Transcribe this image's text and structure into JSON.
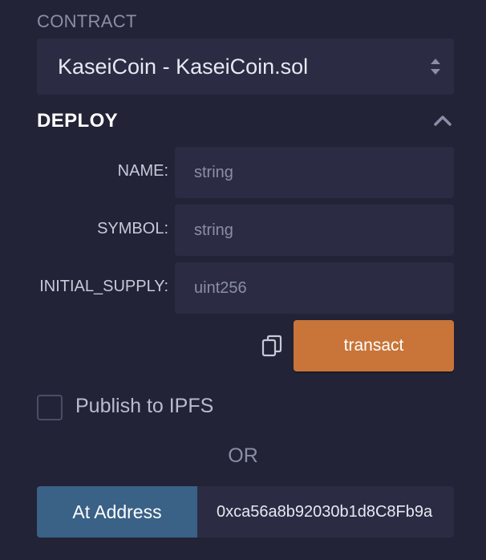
{
  "contract": {
    "label": "CONTRACT",
    "selected": "KaseiCoin - KaseiCoin.sol",
    "icon": "select-arrows-icon"
  },
  "deploy": {
    "title": "DEPLOY",
    "collapse_icon": "chevron-up-icon",
    "params": [
      {
        "label": "NAME:",
        "placeholder": "string"
      },
      {
        "label": "SYMBOL:",
        "placeholder": "string"
      },
      {
        "label": "INITIAL_SUPPLY:",
        "placeholder": "uint256"
      }
    ],
    "copy_icon": "copy-icon",
    "transact_label": "transact"
  },
  "publish": {
    "label": "Publish to IPFS",
    "checked": false
  },
  "or_label": "OR",
  "at_address": {
    "button_label": "At Address",
    "value": "0xca56a8b92030b1d8C8Fb9a"
  },
  "colors": {
    "background": "#222336",
    "panel": "#2b2c43",
    "transact": "#c97539",
    "at_address": "#3a6186"
  }
}
